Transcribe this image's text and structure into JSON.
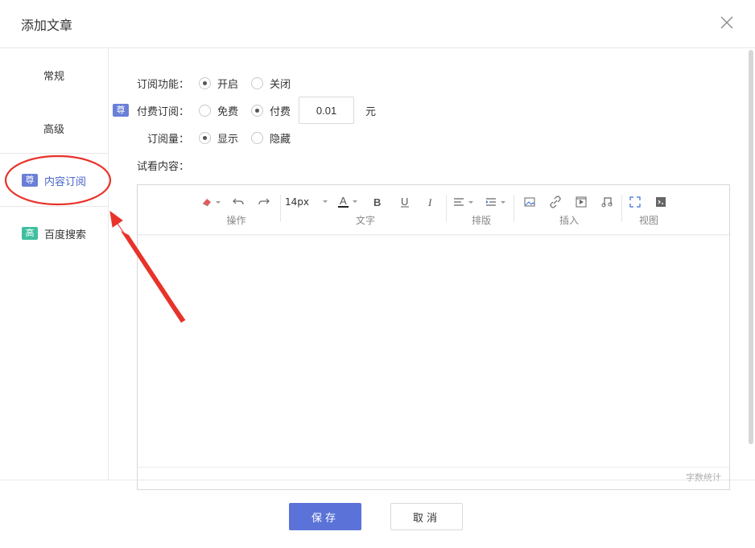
{
  "dialog": {
    "title": "添加文章"
  },
  "sidebar": {
    "items": [
      {
        "label": "常规"
      },
      {
        "label": "高级"
      },
      {
        "label": "内容订阅",
        "badge": "尊",
        "badge_color": "#6a7fd6"
      },
      {
        "label": "百度搜索",
        "badge": "高",
        "badge_color": "#3fbfa0"
      }
    ],
    "active_index": 2
  },
  "form": {
    "subscription": {
      "label": "订阅功能：",
      "options": [
        "开启",
        "关闭"
      ],
      "selected": "开启"
    },
    "paid": {
      "badge": "尊",
      "label": "付费订阅：",
      "options": [
        "免费",
        "付费"
      ],
      "selected": "付费",
      "price": "0.01",
      "unit": "元"
    },
    "count": {
      "label": "订阅量：",
      "options": [
        "显示",
        "隐藏"
      ],
      "selected": "显示"
    },
    "preview_label": "试看内容："
  },
  "editor": {
    "font_size": "14px",
    "groups": [
      "操作",
      "文字",
      "排版",
      "插入",
      "视图"
    ],
    "word_count": "字数统计"
  },
  "footer": {
    "save": "保存",
    "cancel": "取消"
  },
  "colors": {
    "accent": "#5b73d8",
    "annotation": "#e8332a"
  }
}
